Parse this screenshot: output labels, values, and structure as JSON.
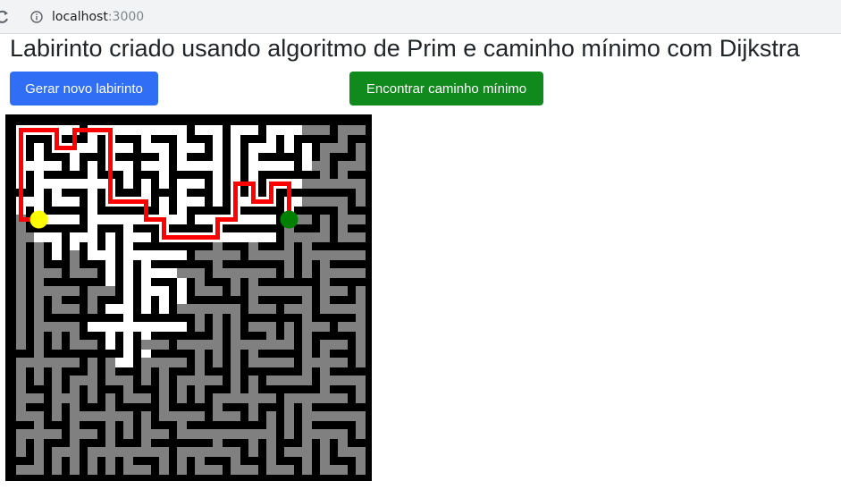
{
  "browser": {
    "url_host": "localhost",
    "url_port": ":3000",
    "reload_icon": "reload-icon",
    "info_icon": "info-icon"
  },
  "page": {
    "title": "Labirinto criado usando algoritmo de Prim e caminho mínimo com Dijkstra"
  },
  "buttons": {
    "new_maze": "Gerar novo labirinto",
    "find_path": "Encontrar caminho mínimo"
  },
  "maze": {
    "cells": 20,
    "background_color": "#000000",
    "corridor_color": "#808080",
    "visited_color": "#ffffff",
    "path_color": "#ff0000",
    "start_color": "#ffff00",
    "end_color": "#008000",
    "start_cell": [
      1,
      5
    ],
    "end_cell": [
      15,
      5
    ],
    "path": [
      [
        1,
        5
      ],
      [
        0,
        5
      ],
      [
        0,
        4
      ],
      [
        0,
        3
      ],
      [
        0,
        2
      ],
      [
        0,
        1
      ],
      [
        0,
        0
      ],
      [
        1,
        0
      ],
      [
        2,
        0
      ],
      [
        2,
        1
      ],
      [
        3,
        1
      ],
      [
        3,
        0
      ],
      [
        4,
        0
      ],
      [
        5,
        0
      ],
      [
        5,
        1
      ],
      [
        5,
        2
      ],
      [
        5,
        3
      ],
      [
        5,
        4
      ],
      [
        6,
        4
      ],
      [
        7,
        4
      ],
      [
        7,
        5
      ],
      [
        8,
        5
      ],
      [
        8,
        6
      ],
      [
        9,
        6
      ],
      [
        10,
        6
      ],
      [
        11,
        6
      ],
      [
        11,
        5
      ],
      [
        12,
        5
      ],
      [
        12,
        4
      ],
      [
        12,
        3
      ],
      [
        13,
        3
      ],
      [
        13,
        4
      ],
      [
        14,
        4
      ],
      [
        14,
        3
      ],
      [
        15,
        3
      ],
      [
        15,
        4
      ],
      [
        15,
        5
      ]
    ],
    "visited_region": [
      [
        0,
        0
      ],
      [
        1,
        0
      ],
      [
        2,
        0
      ],
      [
        3,
        0
      ],
      [
        4,
        0
      ],
      [
        5,
        0
      ],
      [
        6,
        0
      ],
      [
        7,
        0
      ],
      [
        8,
        0
      ],
      [
        9,
        0
      ],
      [
        10,
        0
      ],
      [
        11,
        0
      ],
      [
        12,
        0
      ],
      [
        13,
        0
      ],
      [
        14,
        0
      ],
      [
        15,
        0
      ],
      [
        16,
        0
      ],
      [
        0,
        1
      ],
      [
        1,
        1
      ],
      [
        2,
        1
      ],
      [
        3,
        1
      ],
      [
        4,
        1
      ],
      [
        5,
        1
      ],
      [
        6,
        1
      ],
      [
        7,
        1
      ],
      [
        8,
        1
      ],
      [
        9,
        1
      ],
      [
        10,
        1
      ],
      [
        11,
        1
      ],
      [
        12,
        1
      ],
      [
        13,
        1
      ],
      [
        14,
        1
      ],
      [
        15,
        1
      ],
      [
        16,
        1
      ],
      [
        0,
        2
      ],
      [
        1,
        2
      ],
      [
        2,
        2
      ],
      [
        3,
        2
      ],
      [
        4,
        2
      ],
      [
        5,
        2
      ],
      [
        6,
        2
      ],
      [
        7,
        2
      ],
      [
        8,
        2
      ],
      [
        9,
        2
      ],
      [
        10,
        2
      ],
      [
        11,
        2
      ],
      [
        12,
        2
      ],
      [
        13,
        2
      ],
      [
        14,
        2
      ],
      [
        15,
        2
      ],
      [
        16,
        2
      ],
      [
        0,
        3
      ],
      [
        1,
        3
      ],
      [
        2,
        3
      ],
      [
        3,
        3
      ],
      [
        4,
        3
      ],
      [
        5,
        3
      ],
      [
        6,
        3
      ],
      [
        7,
        3
      ],
      [
        8,
        3
      ],
      [
        9,
        3
      ],
      [
        10,
        3
      ],
      [
        11,
        3
      ],
      [
        12,
        3
      ],
      [
        13,
        3
      ],
      [
        14,
        3
      ],
      [
        15,
        3
      ],
      [
        16,
        3
      ],
      [
        0,
        4
      ],
      [
        1,
        4
      ],
      [
        2,
        4
      ],
      [
        3,
        4
      ],
      [
        4,
        4
      ],
      [
        5,
        4
      ],
      [
        6,
        4
      ],
      [
        7,
        4
      ],
      [
        8,
        4
      ],
      [
        9,
        4
      ],
      [
        10,
        4
      ],
      [
        11,
        4
      ],
      [
        12,
        4
      ],
      [
        13,
        4
      ],
      [
        14,
        4
      ],
      [
        15,
        4
      ],
      [
        16,
        4
      ],
      [
        0,
        5
      ],
      [
        1,
        5
      ],
      [
        2,
        5
      ],
      [
        3,
        5
      ],
      [
        4,
        5
      ],
      [
        5,
        5
      ],
      [
        6,
        5
      ],
      [
        7,
        5
      ],
      [
        8,
        5
      ],
      [
        9,
        5
      ],
      [
        10,
        5
      ],
      [
        11,
        5
      ],
      [
        12,
        5
      ],
      [
        13,
        5
      ],
      [
        14,
        5
      ],
      [
        15,
        5
      ],
      [
        1,
        6
      ],
      [
        2,
        6
      ],
      [
        3,
        6
      ],
      [
        4,
        6
      ],
      [
        5,
        6
      ],
      [
        6,
        6
      ],
      [
        7,
        6
      ],
      [
        8,
        6
      ],
      [
        9,
        6
      ],
      [
        10,
        6
      ],
      [
        11,
        6
      ],
      [
        12,
        6
      ],
      [
        13,
        6
      ],
      [
        14,
        6
      ],
      [
        2,
        7
      ],
      [
        3,
        7
      ],
      [
        4,
        7
      ],
      [
        5,
        7
      ],
      [
        6,
        7
      ],
      [
        7,
        7
      ],
      [
        8,
        7
      ],
      [
        9,
        7
      ],
      [
        4,
        8
      ],
      [
        5,
        8
      ],
      [
        6,
        8
      ],
      [
        7,
        8
      ],
      [
        8,
        8
      ],
      [
        9,
        8
      ],
      [
        5,
        9
      ],
      [
        6,
        9
      ],
      [
        7,
        9
      ],
      [
        8,
        9
      ],
      [
        9,
        9
      ],
      [
        5,
        10
      ],
      [
        6,
        10
      ],
      [
        7,
        10
      ],
      [
        8,
        10
      ],
      [
        9,
        10
      ],
      [
        4,
        11
      ],
      [
        5,
        11
      ],
      [
        6,
        11
      ],
      [
        7,
        11
      ],
      [
        8,
        11
      ],
      [
        9,
        11
      ],
      [
        4,
        12
      ],
      [
        5,
        12
      ],
      [
        6,
        12
      ],
      [
        7,
        12
      ],
      [
        4,
        13
      ],
      [
        5,
        13
      ],
      [
        6,
        13
      ],
      [
        7,
        13
      ]
    ]
  }
}
